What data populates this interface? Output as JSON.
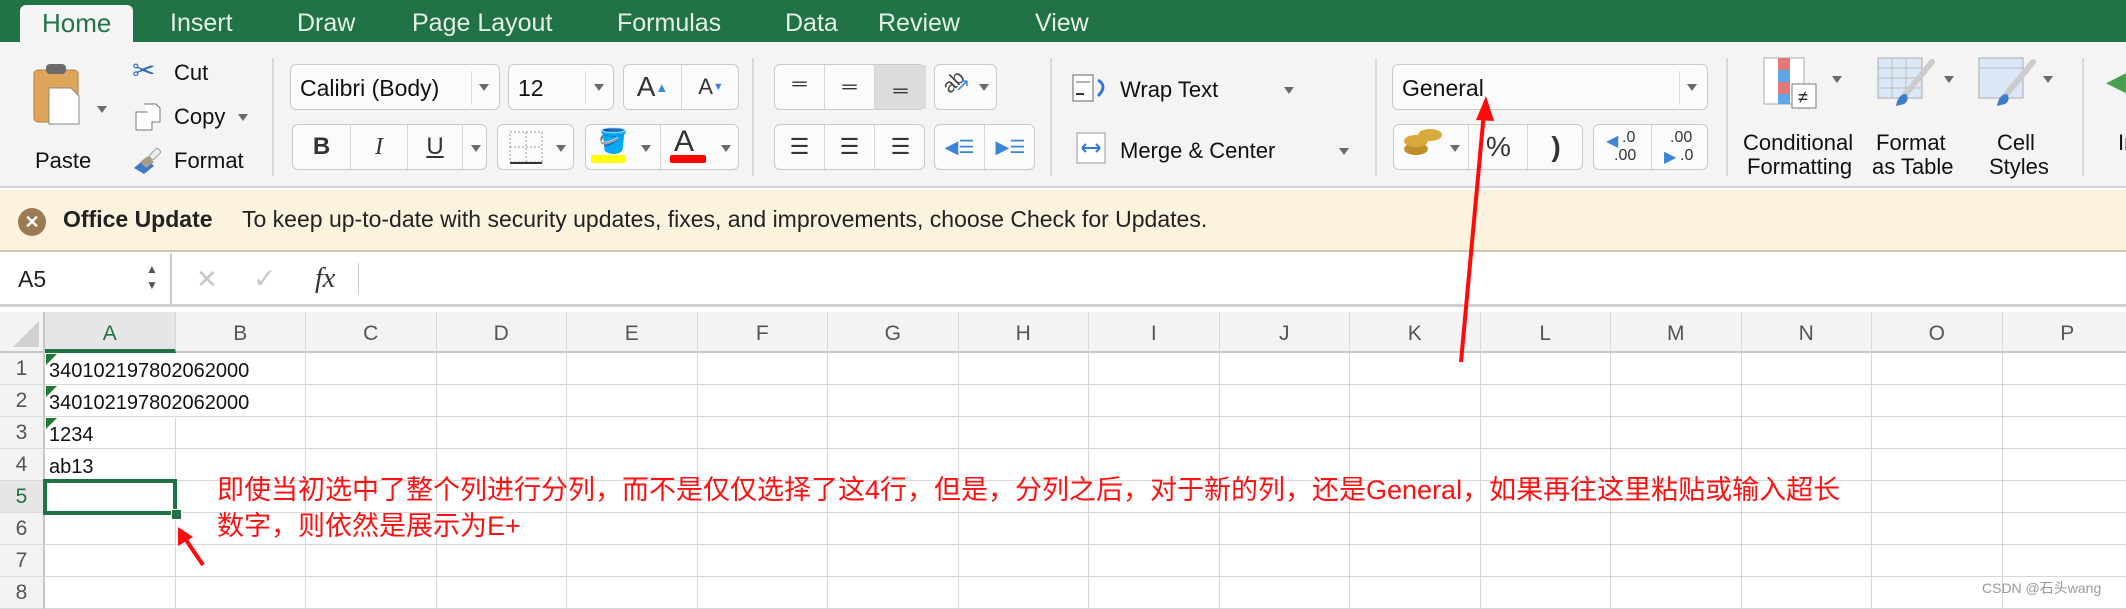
{
  "tabs": [
    "Home",
    "Insert",
    "Draw",
    "Page Layout",
    "Formulas",
    "Data",
    "Review",
    "View"
  ],
  "active_tab": "Home",
  "clipboard": {
    "paste": "Paste",
    "cut": "Cut",
    "copy": "Copy",
    "format": "Format"
  },
  "font": {
    "name": "Calibri (Body)",
    "size": "12",
    "increase": "A",
    "decrease": "A",
    "bold": "B",
    "italic": "I",
    "underline": "U",
    "font_color_letter": "A",
    "fill_color": "#ffff00",
    "font_color": "#ff0000"
  },
  "alignment": {
    "wrap_text": "Wrap Text",
    "merge_center": "Merge & Center"
  },
  "number": {
    "format": "General",
    "percent": "%",
    "comma": ")",
    "inc_decimal_top": ".0",
    "inc_decimal_bottom": ".00",
    "dec_decimal_top": ".00",
    "dec_decimal_bottom": ".0"
  },
  "styles": {
    "conditional_1": "Conditional",
    "conditional_2": "Formatting",
    "table_1": "Format",
    "table_2": "as Table",
    "cell_1": "Cell",
    "cell_2": "Styles",
    "insert_partial": "In"
  },
  "update_bar": {
    "title": "Office Update",
    "message": "To keep up-to-date with security updates, fixes, and improvements, choose Check for Updates."
  },
  "formula_bar": {
    "name_box": "A5",
    "cancel": "✕",
    "enter": "✓",
    "fx": "fx",
    "value": ""
  },
  "grid": {
    "columns": [
      "A",
      "B",
      "C",
      "D",
      "E",
      "F",
      "G",
      "H",
      "I",
      "J",
      "K",
      "L",
      "M",
      "N",
      "O",
      "P"
    ],
    "rows": [
      "1",
      "2",
      "3",
      "4",
      "5",
      "6",
      "7",
      "8"
    ],
    "selected_cell": "A5",
    "cells": [
      {
        "ref": "A1",
        "value": "340102197802062000",
        "text_flag": true
      },
      {
        "ref": "A2",
        "value": "340102197802062000",
        "text_flag": true
      },
      {
        "ref": "A3",
        "value": "1234",
        "text_flag": true
      },
      {
        "ref": "A4",
        "value": "ab13",
        "text_flag": false
      }
    ]
  },
  "annotation": {
    "line1": "即使当初选中了整个列进行分列，而不是仅仅选择了这4行，但是，分列之后，对于新的列，还是General，如果再往这里粘贴或输入超长",
    "line2": "数字，则依然是展示为E+",
    "color": "#ff1010"
  },
  "watermark": "CSDN @石头wang",
  "colors": {
    "accent": "#217346",
    "annotation": "#ff0000"
  }
}
